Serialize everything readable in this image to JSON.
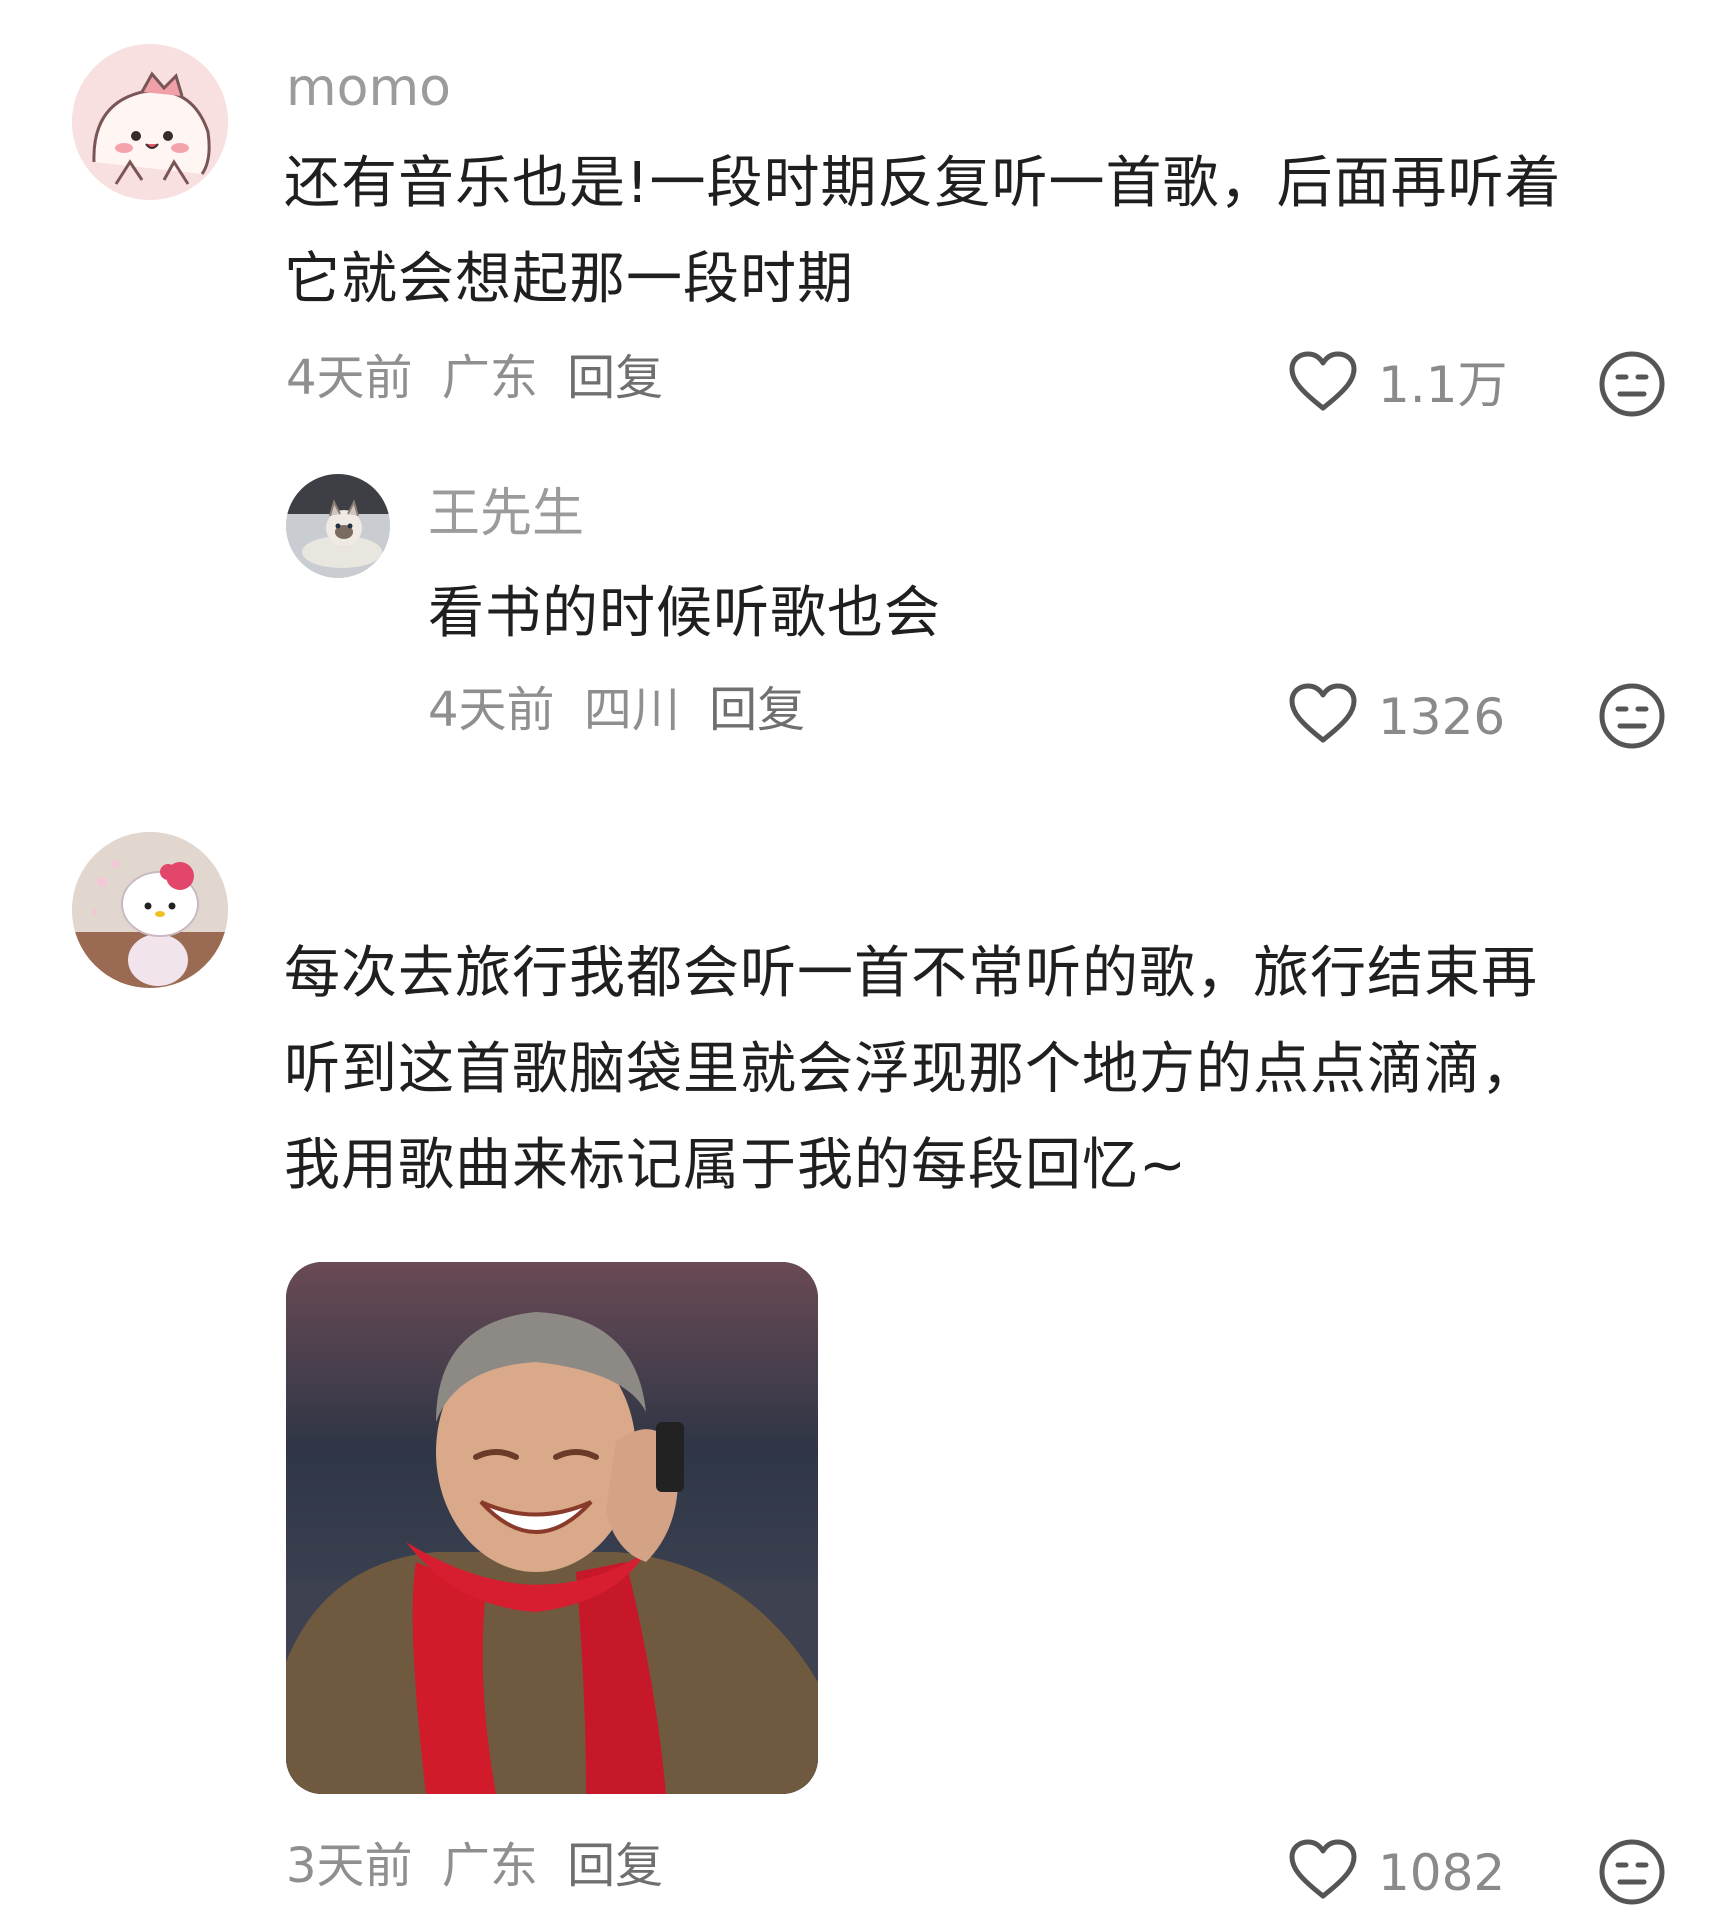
{
  "comments": [
    {
      "username": "momo",
      "text_lines": [
        "还有音乐也是!一段时期反复听一首歌，后面再听着",
        "它就会想起那一段时期"
      ],
      "time": "4天前",
      "location": "广东",
      "reply_label": "回复",
      "likes": "1.1万",
      "replies": [
        {
          "username": "王先生",
          "text_lines": [
            "看书的时候听歌也会"
          ],
          "time": "4天前",
          "location": "四川",
          "reply_label": "回复",
          "likes": "1326"
        }
      ]
    },
    {
      "username": "",
      "text_lines": [
        "每次去旅行我都会听一首不常听的歌，旅行结束再",
        "听到这首歌脑袋里就会浮现那个地方的点点滴滴，",
        "我用歌曲来标记属于我的每段回忆~"
      ],
      "time": "3天前",
      "location": "广东",
      "reply_label": "回复",
      "likes": "1082"
    }
  ],
  "icons": {
    "like": "heart-outline-icon",
    "dislike": "meh-face-icon"
  },
  "colors": {
    "text_primary": "#1f1f1f",
    "text_secondary": "#8f8f8f",
    "icon_stroke": "#555555",
    "scarf_red": "#d11a2a"
  }
}
